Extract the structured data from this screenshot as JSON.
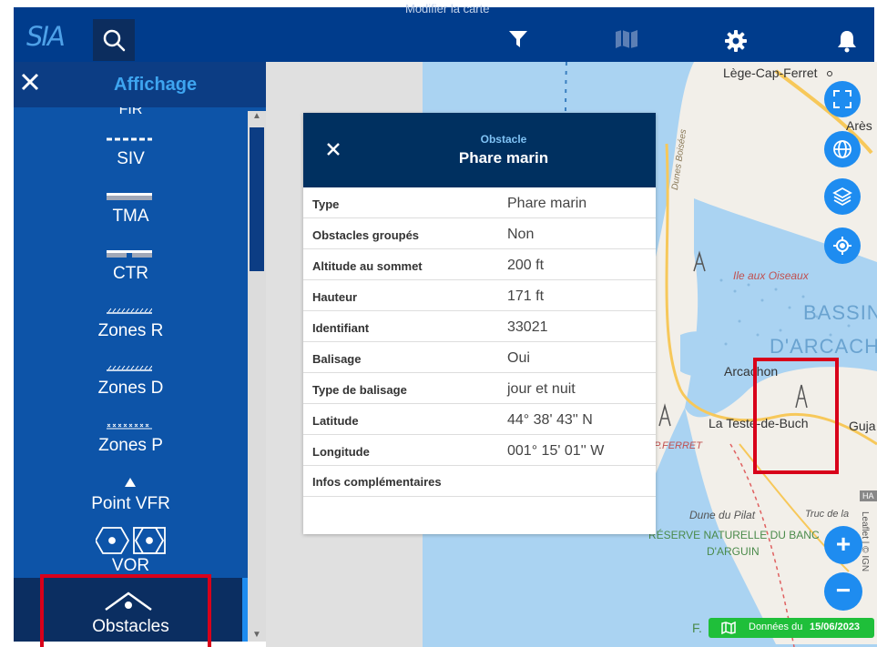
{
  "topbar": {
    "caption": "Modifier la carte",
    "logo": "SIA",
    "icons": [
      "search-icon",
      "filter-icon",
      "map-icon",
      "gear-icon",
      "bell-icon"
    ]
  },
  "sidebar": {
    "title": "Affichage",
    "partial_top_label": "FIR",
    "layers": [
      "SIV",
      "TMA",
      "CTR",
      "Zones R",
      "Zones D",
      "Zones P",
      "Point VFR",
      "VOR",
      "Obstacles"
    ]
  },
  "popup": {
    "subtitle": "Obstacle",
    "title": "Phare marin",
    "rows": [
      {
        "key": "Type",
        "value": "Phare marin"
      },
      {
        "key": "Obstacles groupés",
        "value": "Non"
      },
      {
        "key": "Altitude au sommet",
        "value": "200 ft"
      },
      {
        "key": "Hauteur",
        "value": "171 ft"
      },
      {
        "key": "Identifiant",
        "value": "33021"
      },
      {
        "key": "Balisage",
        "value": "Oui"
      },
      {
        "key": "Type de balisage",
        "value": "jour et nuit"
      },
      {
        "key": "Latitude",
        "value": "44° 38' 43'' N"
      },
      {
        "key": "Longitude",
        "value": "001° 15' 01'' W"
      },
      {
        "key": "Infos complémentaires",
        "value": ""
      }
    ]
  },
  "map": {
    "labels": {
      "lege": "Lège-Cap-Ferret",
      "ares": "Arès",
      "dunes": "Dunes Boisées",
      "ile": "Ile aux Oiseaux",
      "bassin": "BASSIN",
      "darcach": "D'ARCACH",
      "arcachon": "Arcachon",
      "teste": "La Teste-de-Buch",
      "guja": "Guja",
      "ferret": "P.FERRET",
      "dune": "Dune du Pilat",
      "truc": "Truc de la",
      "reserve": "RÉSERVE NATURELLE DU BANC",
      "arguin": "D'ARGUIN",
      "f": "F.",
      "leaflet": "Leaflet | © IGN",
      "ha": "HA"
    },
    "zoom_in": "+",
    "zoom_out": "−",
    "data_prefix": "Données du",
    "data_date": "15/06/2023"
  },
  "colors": {
    "header": "#003c8c",
    "sidebar": "#0d54a8",
    "accent": "#1e8cf0",
    "highlight": "#d8001a",
    "badge": "#1fbf3a",
    "sea": "#aad3f2",
    "land": "#f2efe9"
  }
}
